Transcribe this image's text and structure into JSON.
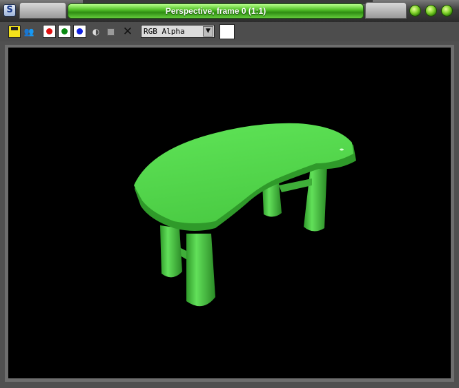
{
  "window": {
    "title": "Perspective, frame 0 (1:1)",
    "app_icon_glyph": "S",
    "accent_color": "#4fc62a"
  },
  "toolbar": {
    "save_icon": "save-icon",
    "clone_icon": "clone-icon",
    "clone_glyph": "👥",
    "channels": [
      {
        "name": "red-channel-button",
        "color": "#e01010"
      },
      {
        "name": "green-channel-button",
        "color": "#0a8a12"
      },
      {
        "name": "blue-channel-button",
        "color": "#1020e0"
      }
    ],
    "mono_glyph": "◐",
    "clear_glyph": "✕",
    "channel_select": {
      "value": "RGB Alpha",
      "arrow": "▼"
    },
    "swatch_color": "#ffffff"
  },
  "viewport": {
    "background": "#000000",
    "object": "table",
    "object_color": "#56d84f"
  }
}
